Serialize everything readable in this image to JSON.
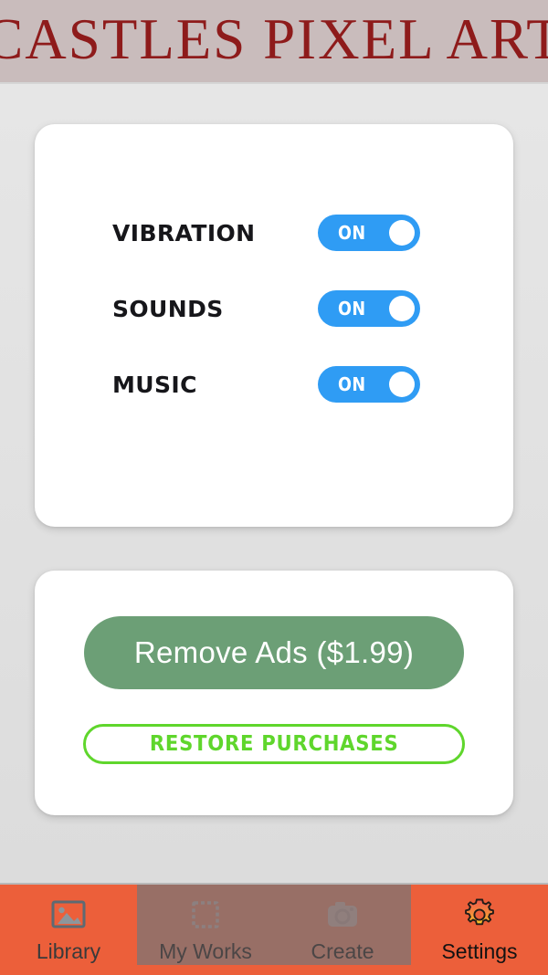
{
  "header": {
    "title": "CASTLES PIXEL ART",
    "background_color": "#c9bcbc",
    "text_color": "#8e1b1b"
  },
  "page": {
    "background_color": "#e2e2e2"
  },
  "settings_card": {
    "rows": [
      {
        "label": "VIBRATION",
        "toggle_state": "ON",
        "enabled": true
      },
      {
        "label": "SOUNDS",
        "toggle_state": "ON",
        "enabled": true
      },
      {
        "label": "MUSIC",
        "toggle_state": "ON",
        "enabled": true
      }
    ],
    "toggle_on_color": "#2f9cf4",
    "toggle_knob_color": "#ffffff"
  },
  "purchase_card": {
    "remove_ads_label": "Remove Ads ($1.99)",
    "remove_ads_color": "#6c9f76",
    "restore_label": "RESTORE PURCHASES",
    "restore_color": "#5fd62c"
  },
  "bottom_nav": {
    "active_color": "#ec5f3a",
    "inactive_overlay": "#807373",
    "items": [
      {
        "label": "Library",
        "icon": "image-icon",
        "active": true,
        "selected": false
      },
      {
        "label": "My Works",
        "icon": "stamp-icon",
        "active": false,
        "selected": false
      },
      {
        "label": "Create",
        "icon": "camera-icon",
        "active": false,
        "selected": false
      },
      {
        "label": "Settings",
        "icon": "gear-icon",
        "active": true,
        "selected": true
      }
    ]
  }
}
